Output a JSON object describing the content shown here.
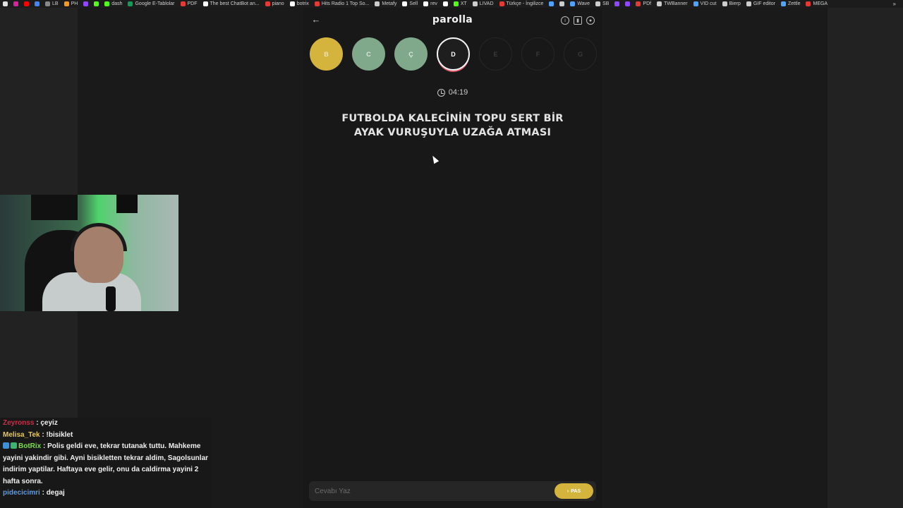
{
  "bookmarks": [
    {
      "icon": "bookmark-icon",
      "label": "",
      "color": "#e0e0e0"
    },
    {
      "icon": "instagram-icon",
      "label": "",
      "color": "#d6249f"
    },
    {
      "icon": "youtube-icon",
      "label": "",
      "color": "#ff0000"
    },
    {
      "icon": "chrome-icon",
      "label": "",
      "color": "#4285f4"
    },
    {
      "icon": "lb-icon",
      "label": "LB",
      "color": "#888888"
    },
    {
      "icon": "ph-icon",
      "label": "PH",
      "color": "#f7971d"
    },
    {
      "icon": "twitch-icon",
      "label": "",
      "color": "#9146ff"
    },
    {
      "icon": "kick-icon",
      "label": "",
      "color": "#53fc18"
    },
    {
      "icon": "dash-icon",
      "label": "dash",
      "color": "#53fc18"
    },
    {
      "icon": "sheets-icon",
      "label": "Google E-Tablolar",
      "color": "#0f9d58"
    },
    {
      "icon": "pdf-icon",
      "label": "PDF",
      "color": "#e53935"
    },
    {
      "icon": "chatbot-icon",
      "label": "The best ChatBot an...",
      "color": "#ffffff"
    },
    {
      "icon": "piano-icon",
      "label": "piano",
      "color": "#e53935"
    },
    {
      "icon": "botrix-icon",
      "label": "botrix",
      "color": "#ffffff"
    },
    {
      "icon": "radio-icon",
      "label": "Hits Radio 1 Top So...",
      "color": "#e53935"
    },
    {
      "icon": "metafy-icon",
      "label": "Metafy",
      "color": "#cccccc"
    },
    {
      "icon": "amazon-icon",
      "label": "Sell",
      "color": "#ffffff"
    },
    {
      "icon": "amazon-icon",
      "label": "rev",
      "color": "#ffffff"
    },
    {
      "icon": "b-icon",
      "label": "",
      "color": "#ffffff"
    },
    {
      "icon": "xt-icon",
      "label": "XT",
      "color": "#53fc18"
    },
    {
      "icon": "livad-icon",
      "label": "LIVAD",
      "color": "#cccccc"
    },
    {
      "icon": "translate-icon",
      "label": "Türkçe - İngilizce",
      "color": "#e53935"
    },
    {
      "icon": "drop-icon",
      "label": "",
      "color": "#4fa3ff"
    },
    {
      "icon": "at-icon",
      "label": "",
      "color": "#cccccc"
    },
    {
      "icon": "wave-icon",
      "label": "Wave",
      "color": "#4fa3ff"
    },
    {
      "icon": "sb-icon",
      "label": "SB",
      "color": "#cccccc"
    },
    {
      "icon": "circle-icon",
      "label": "",
      "color": "#9146ff"
    },
    {
      "icon": "twitch-icon",
      "label": "",
      "color": "#9146ff"
    },
    {
      "icon": "pdf-icon",
      "label": "PDf",
      "color": "#e53935"
    },
    {
      "icon": "tw-icon",
      "label": "TWBanner",
      "color": "#cccccc"
    },
    {
      "icon": "vid-icon",
      "label": "VID cut",
      "color": "#4fa3ff"
    },
    {
      "icon": "bierp-icon",
      "label": "Bierp",
      "color": "#cccccc"
    },
    {
      "icon": "gif-icon",
      "label": "GIF editor",
      "color": "#cccccc"
    },
    {
      "icon": "zettle-icon",
      "label": "Zettle",
      "color": "#4fa3ff"
    },
    {
      "icon": "mega-icon",
      "label": "MEGA",
      "color": "#e53935"
    }
  ],
  "bookmarks_more": "»",
  "game": {
    "brand": "parolla",
    "back_icon": "←",
    "letters": [
      {
        "label": "B",
        "state": "correct-yellow"
      },
      {
        "label": "C",
        "state": "correct-green"
      },
      {
        "label": "Ç",
        "state": "correct-green"
      },
      {
        "label": "D",
        "state": "active"
      },
      {
        "label": "E",
        "state": "pending"
      },
      {
        "label": "F",
        "state": "pending"
      },
      {
        "label": "G",
        "state": "pending"
      }
    ],
    "timer": "04:19",
    "question": "FUTBOLDA KALECİNİN TOPU SERT BİR AYAK VURUŞUYLA UZAĞA ATMASI",
    "answer_placeholder": "Cevabı Yaz",
    "pas_label": "PAS",
    "colors": {
      "yellow": "#d4b43d",
      "green": "#7fa98a",
      "active_ring": "#e05a68"
    }
  },
  "chat": [
    {
      "user": "Zeyronss",
      "user_color": "#c8304a",
      "message": "çeyiz",
      "badges": []
    },
    {
      "user": "Melisa_Tek",
      "user_color": "#e6c85a",
      "message": "!bisiklet",
      "badges": []
    },
    {
      "user": "BotRix",
      "user_color": "#7ddc4a",
      "message": "Polis geldi eve, tekrar tutanak tuttu. Mahkeme yayini yakindir gibi. Ayni bisikletten tekrar aldim, Sagolsunlar indirim yaptilar. Haftaya eve gelir, onu da caldirma yayini 2 hafta sonra.",
      "badges": [
        "bot-badge",
        "verified-badge"
      ]
    },
    {
      "user": "pidecicimri",
      "user_color": "#5a9ce6",
      "message": "degaj",
      "badges": []
    }
  ]
}
